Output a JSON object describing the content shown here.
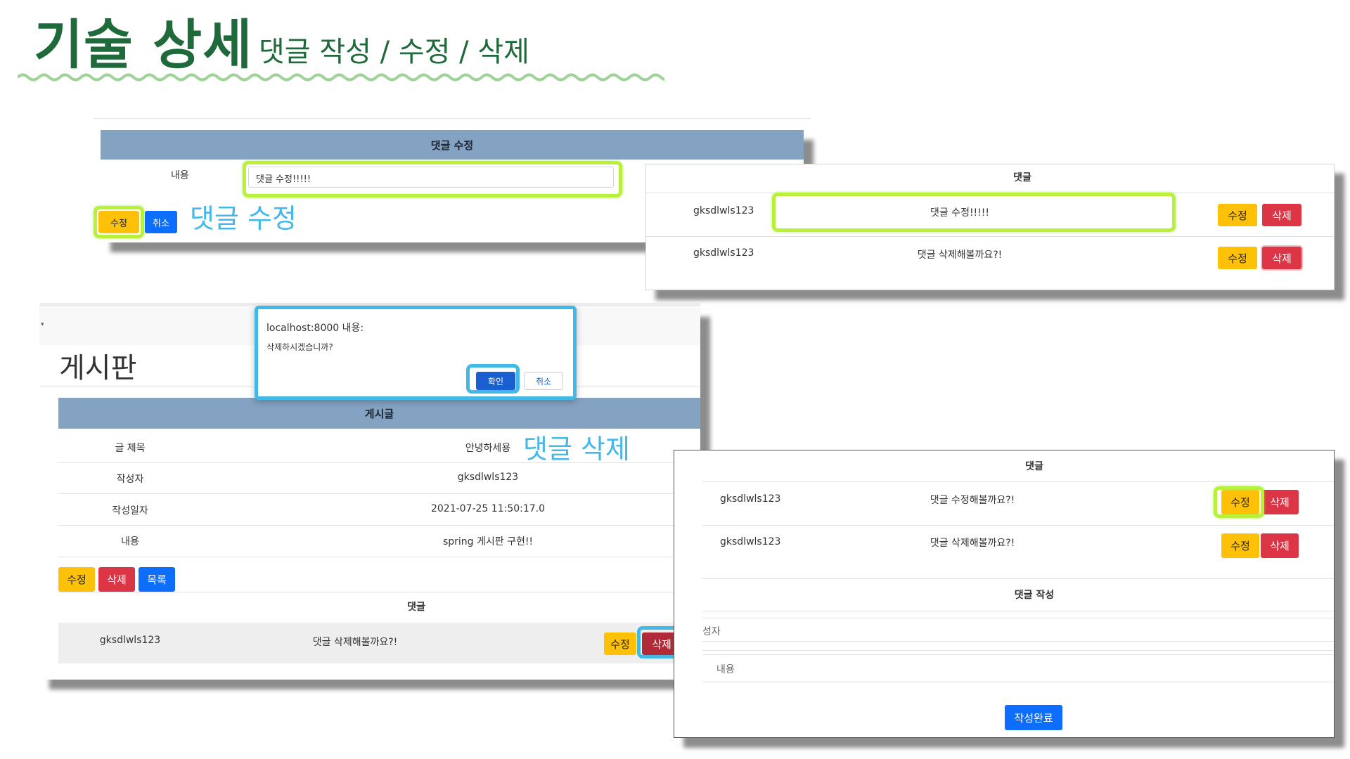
{
  "header": {
    "title": "기술 상세",
    "subtitle": "댓글 작성 / 수정 / 삭제"
  },
  "colors": {
    "title_green": "#1f6a3a",
    "highlight_green": "#b8f03a",
    "highlight_blue": "#41b8e6",
    "table_header": "#84a3c2",
    "warning": "#ffc107",
    "danger": "#dc3545",
    "primary": "#0d6efd"
  },
  "edit_panel": {
    "header": "댓글 수정",
    "content_label": "내용",
    "content_value": "댓글 수정!!!!!",
    "edit_button": "수정",
    "cancel_button": "취소",
    "callout": "댓글 수정"
  },
  "comments_panel_top": {
    "header": "댓글",
    "rows": [
      {
        "author": "gksdlwls123",
        "content": "댓글 수정!!!!!",
        "edit": "수정",
        "delete": "삭제"
      },
      {
        "author": "gksdlwls123",
        "content": "댓글 삭제해볼까요?!",
        "edit": "수정",
        "delete": "삭제"
      }
    ]
  },
  "board_panel": {
    "page_title": "게시판",
    "table_header": "게시글",
    "fields": [
      {
        "label": "글 제목",
        "value": "안녕하세용"
      },
      {
        "label": "작성자",
        "value": "gksdlwls123"
      },
      {
        "label": "작성일자",
        "value": "2021-07-25 11:50:17.0"
      },
      {
        "label": "내용",
        "value": "spring 게시판 구현!!"
      }
    ],
    "edit_button": "수정",
    "delete_button": "삭제",
    "list_button": "목록",
    "comments_header": "댓글",
    "comment": {
      "author": "gksdlwls123",
      "content": "댓글 삭제해볼까요?!",
      "edit": "수정",
      "delete": "삭제"
    },
    "callout": "댓글 삭제"
  },
  "dialog": {
    "origin": "localhost:8000 내용:",
    "message": "삭제하시겠습니까?",
    "ok_button": "확인",
    "cancel_button": "취소"
  },
  "write_panel": {
    "comments_header": "댓글",
    "rows": [
      {
        "author": "gksdlwls123",
        "content": "댓글 수정해볼까요?!",
        "edit": "수정",
        "delete": "삭제"
      },
      {
        "author": "gksdlwls123",
        "content": "댓글 삭제해볼까요?!",
        "edit": "수정",
        "delete": "삭제"
      }
    ],
    "write_header": "댓글 작성",
    "author_placeholder": "성자",
    "content_placeholder": "내용",
    "submit_button": "작성완료"
  }
}
